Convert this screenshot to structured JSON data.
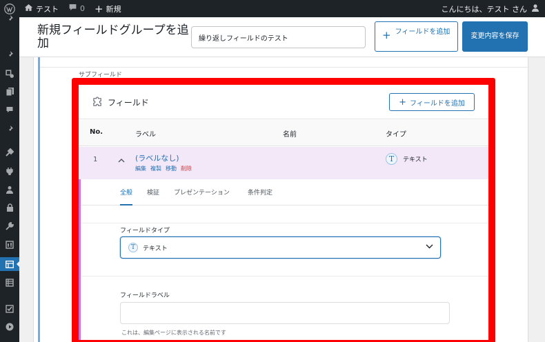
{
  "adminbar": {
    "site_name": "テスト",
    "comments_count": "0",
    "new_label": "新規",
    "greeting": "こんにちは、テスト さん"
  },
  "sidemenu": {
    "items": [
      "pin-icon",
      "pin-icon",
      "pin-icon",
      "media-icon",
      "pages-icon",
      "comments-icon",
      "pin-icon",
      "appearance-icon",
      "plugins-icon",
      "users-icon",
      "lock-icon",
      "tools-icon",
      "settings-icon",
      "field-groups-icon",
      "table-icon",
      "checkbox-icon",
      "play-icon"
    ],
    "active_index": 13
  },
  "header": {
    "page_title": "新規フィールドグループを追加",
    "title_input_value": "繰り返しフィールドのテスト",
    "add_field_label": "フィールドを追加",
    "save_label": "変更内容を保存"
  },
  "subfields": {
    "section_label": "サブフィールド",
    "panel_title": "フィールド",
    "add_field_label": "フィールドを追加",
    "columns": {
      "no": "No.",
      "label": "ラベル",
      "name": "名前",
      "type": "タイプ"
    },
    "row": {
      "number": "1",
      "label": "(ラベルなし)",
      "actions": {
        "edit": "編集",
        "duplicate": "複製",
        "move": "移動",
        "delete": "削除"
      },
      "type_icon_letter": "T",
      "type": "テキスト"
    },
    "tabs": [
      "全般",
      "検証",
      "プレゼンテーション",
      "条件判定"
    ],
    "active_tab": 0,
    "field_type_label": "フィールドタイプ",
    "field_type_value": "テキスト",
    "field_label_label": "フィールドラベル",
    "field_label_value": "",
    "field_label_help": "これは、編集ページに表示される名前です"
  },
  "colors": {
    "admin_dark": "#1d2327",
    "primary_blue": "#2271b1",
    "row_highlight": "#f3e8f8",
    "accent_purple": "#c277e6",
    "delete_red": "#d63638",
    "annotation_red": "#ff0000"
  }
}
